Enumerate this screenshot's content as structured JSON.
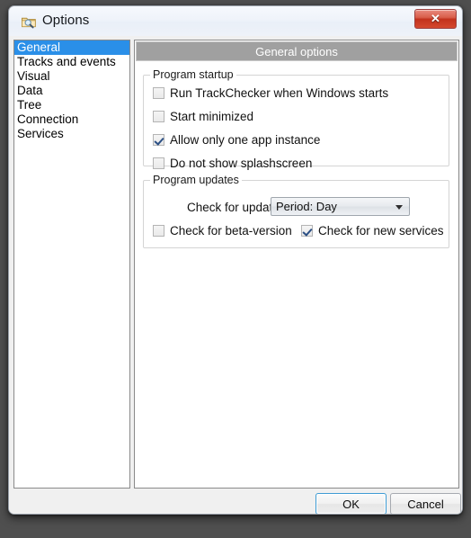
{
  "window": {
    "title": "Options",
    "title_icon": "options-folder-search-icon",
    "close_label": "✕"
  },
  "sidebar": {
    "items": [
      {
        "label": "General",
        "selected": true
      },
      {
        "label": "Tracks and events",
        "selected": false
      },
      {
        "label": "Visual",
        "selected": false
      },
      {
        "label": "Data",
        "selected": false
      },
      {
        "label": "Tree",
        "selected": false
      },
      {
        "label": "Connection",
        "selected": false
      },
      {
        "label": "Services",
        "selected": false
      }
    ]
  },
  "pane": {
    "header": "General options",
    "groups": {
      "startup": {
        "legend": "Program startup",
        "checkboxes": [
          {
            "label": "Run TrackChecker when Windows starts",
            "checked": false
          },
          {
            "label": "Start minimized",
            "checked": false
          },
          {
            "label": "Allow only one app instance",
            "checked": true
          },
          {
            "label": "Do not show splashscreen",
            "checked": false
          }
        ]
      },
      "updates": {
        "legend": "Program updates",
        "period_label": "Check for updates:",
        "period_value": "Period: Day",
        "period_options": [
          "Period: Day"
        ],
        "checkboxes": [
          {
            "label": "Check for beta-version",
            "checked": false
          },
          {
            "label": "Check for new services",
            "checked": true
          }
        ]
      }
    }
  },
  "footer": {
    "ok_label": "OK",
    "cancel_label": "Cancel"
  },
  "colors": {
    "selection_blue": "#2a8fe8",
    "header_gray": "#a0a0a0",
    "close_red": "#c2321d",
    "focus_blue": "#3f9cd4"
  }
}
